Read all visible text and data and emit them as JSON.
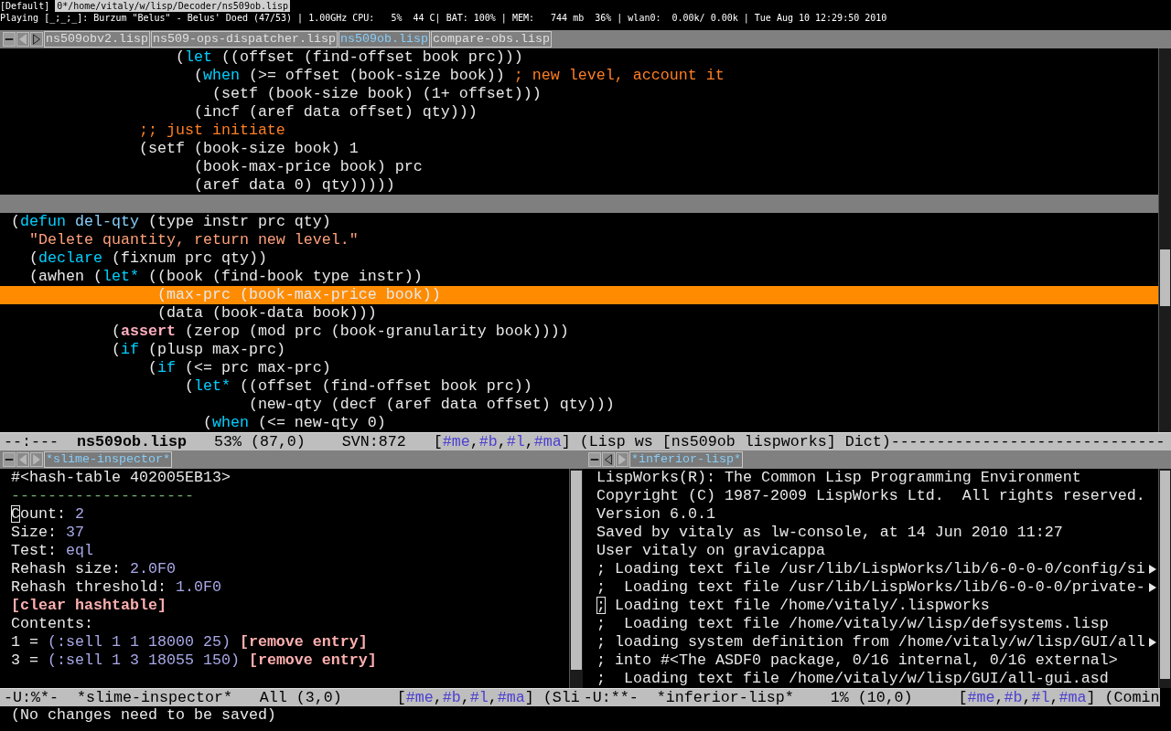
{
  "status_bar": {
    "workspace": "[Default]",
    "path": "0*/home/vitaly/w/lisp/Decoder/ns509ob.lisp",
    "info": "Playing [_;_;_]: Burzum \"Belus\" - Belus' Doed (47/53) | 1.00GHz CPU:   5%  44 C| BAT: 100% | MEM:   744 mb  36% | wlan0:  0.00k/ 0.00k | Tue Aug 10 12:29:50 2010"
  },
  "top_window": {
    "tabs": [
      {
        "label": "ns509obv2.lisp",
        "selected": false
      },
      {
        "label": "ns509-ops-dispatcher.lisp",
        "selected": false
      },
      {
        "label": "ns509ob.lisp",
        "selected": true
      },
      {
        "label": "compare-obs.lisp",
        "selected": false
      }
    ],
    "lines": [
      {
        "kind": "code",
        "highlighted": false,
        "segments": [
          {
            "kind": "plain",
            "text": "                  ("
          },
          {
            "kind": "keyword",
            "text": "let"
          },
          {
            "kind": "plain",
            "text": " ((offset (find-offset book prc)))"
          }
        ]
      },
      {
        "kind": "code",
        "highlighted": false,
        "segments": [
          {
            "kind": "plain",
            "text": "                    ("
          },
          {
            "kind": "keyword",
            "text": "when"
          },
          {
            "kind": "plain",
            "text": " (>= offset (book-size book)) "
          },
          {
            "kind": "comment",
            "text": "; new level, account it"
          }
        ]
      },
      {
        "kind": "code",
        "highlighted": false,
        "segments": [
          {
            "kind": "plain",
            "text": "                      (setf (book-size book) (1+ offset)))"
          }
        ]
      },
      {
        "kind": "code",
        "highlighted": false,
        "segments": [
          {
            "kind": "plain",
            "text": "                    (incf (aref data offset) qty)))"
          }
        ]
      },
      {
        "kind": "code",
        "highlighted": false,
        "segments": [
          {
            "kind": "comment",
            "text": "              ;; just initiate"
          }
        ]
      },
      {
        "kind": "code",
        "highlighted": false,
        "segments": [
          {
            "kind": "plain",
            "text": "              (setf (book-size book) 1"
          }
        ]
      },
      {
        "kind": "code",
        "highlighted": false,
        "segments": [
          {
            "kind": "plain",
            "text": "                    (book-max-price book) prc"
          }
        ]
      },
      {
        "kind": "code",
        "highlighted": false,
        "segments": [
          {
            "kind": "plain",
            "text": "                    (aref data 0) qty)))))"
          }
        ]
      },
      {
        "kind": "rule",
        "highlighted": false
      },
      {
        "kind": "code",
        "highlighted": false,
        "segments": [
          {
            "kind": "plain",
            "text": "("
          },
          {
            "kind": "keyword",
            "text": "defun "
          },
          {
            "kind": "name",
            "text": "del-qty"
          },
          {
            "kind": "plain",
            "text": " (type instr prc qty)"
          }
        ]
      },
      {
        "kind": "code",
        "highlighted": false,
        "segments": [
          {
            "kind": "string",
            "text": "  \"Delete quantity, return new level.\""
          }
        ]
      },
      {
        "kind": "code",
        "highlighted": false,
        "segments": [
          {
            "kind": "plain",
            "text": "  ("
          },
          {
            "kind": "keyword",
            "text": "declare"
          },
          {
            "kind": "plain",
            "text": " (fixnum prc qty))"
          }
        ]
      },
      {
        "kind": "code",
        "highlighted": false,
        "segments": [
          {
            "kind": "plain",
            "text": "  (awhen ("
          },
          {
            "kind": "keyword",
            "text": "let*"
          },
          {
            "kind": "plain",
            "text": " ((book (find-book type instr))"
          }
        ]
      },
      {
        "kind": "code",
        "highlighted": true,
        "segments": [
          {
            "kind": "plain",
            "text": "                (max-prc (book-max-price book))"
          }
        ]
      },
      {
        "kind": "code",
        "highlighted": false,
        "segments": [
          {
            "kind": "plain",
            "text": "                (data (book-data book)))"
          }
        ]
      },
      {
        "kind": "code",
        "highlighted": false,
        "segments": [
          {
            "kind": "plain",
            "text": "           ("
          },
          {
            "kind": "builtin",
            "text": "assert"
          },
          {
            "kind": "plain",
            "text": " (zerop (mod prc (book-granularity book))))"
          }
        ]
      },
      {
        "kind": "code",
        "highlighted": false,
        "segments": [
          {
            "kind": "plain",
            "text": "           ("
          },
          {
            "kind": "keyword",
            "text": "if"
          },
          {
            "kind": "plain",
            "text": " (plusp max-prc)"
          }
        ]
      },
      {
        "kind": "code",
        "highlighted": false,
        "segments": [
          {
            "kind": "plain",
            "text": "               ("
          },
          {
            "kind": "keyword",
            "text": "if"
          },
          {
            "kind": "plain",
            "text": " (<= prc max-prc)"
          }
        ]
      },
      {
        "kind": "code",
        "highlighted": false,
        "segments": [
          {
            "kind": "plain",
            "text": "                   ("
          },
          {
            "kind": "keyword",
            "text": "let*"
          },
          {
            "kind": "plain",
            "text": " ((offset (find-offset book prc))"
          }
        ]
      },
      {
        "kind": "code",
        "highlighted": false,
        "segments": [
          {
            "kind": "plain",
            "text": "                          (new-qty (decf (aref data offset) qty)))"
          }
        ]
      },
      {
        "kind": "code",
        "highlighted": false,
        "segments": [
          {
            "kind": "plain",
            "text": "                     ("
          },
          {
            "kind": "keyword",
            "text": "when"
          },
          {
            "kind": "plain",
            "text": " (<= new-qty 0)"
          }
        ]
      }
    ],
    "mode_line": [
      {
        "kind": "ml",
        "text": "--:---  "
      },
      {
        "kind": "ml-bold",
        "text": "ns509ob.lisp"
      },
      {
        "kind": "ml",
        "text": "   53% (87,0)    SVN:872   ["
      },
      {
        "kind": "ml-tag",
        "text": "#me"
      },
      {
        "kind": "ml",
        "text": ","
      },
      {
        "kind": "ml-tag",
        "text": "#b"
      },
      {
        "kind": "ml",
        "text": ","
      },
      {
        "kind": "ml-tag",
        "text": "#l"
      },
      {
        "kind": "ml",
        "text": ","
      },
      {
        "kind": "ml-tag",
        "text": "#ma"
      },
      {
        "kind": "ml",
        "text": "] (Lisp ws [ns509ob lispworks] Dict)------------------------------"
      }
    ]
  },
  "bottom_left": {
    "tabs": [
      {
        "label": "*slime-inspector*",
        "selected": true
      }
    ],
    "lines": [
      {
        "segments": [
          {
            "kind": "plain",
            "text": "#<hash-table 402005EB13>"
          }
        ]
      },
      {
        "segments": [
          {
            "kind": "rule",
            "text": "--------------------"
          }
        ]
      },
      {
        "segments": [
          {
            "kind": "cursor",
            "text": "C"
          },
          {
            "kind": "plain",
            "text": "ount: "
          },
          {
            "kind": "value",
            "text": "2"
          }
        ]
      },
      {
        "segments": [
          {
            "kind": "plain",
            "text": "Size: "
          },
          {
            "kind": "value",
            "text": "37"
          }
        ]
      },
      {
        "segments": [
          {
            "kind": "plain",
            "text": "Test: "
          },
          {
            "kind": "value",
            "text": "eql"
          }
        ]
      },
      {
        "segments": [
          {
            "kind": "plain",
            "text": "Rehash size: "
          },
          {
            "kind": "value",
            "text": "2.0F0"
          }
        ]
      },
      {
        "segments": [
          {
            "kind": "plain",
            "text": "Rehash threshold: "
          },
          {
            "kind": "value",
            "text": "1.0F0"
          }
        ]
      },
      {
        "segments": [
          {
            "kind": "action",
            "text": "[clear hashtable]"
          }
        ]
      },
      {
        "segments": [
          {
            "kind": "plain",
            "text": "Contents:"
          }
        ]
      },
      {
        "segments": [
          {
            "kind": "plain",
            "text": "1 = "
          },
          {
            "kind": "value",
            "text": "(:sell 1 1 18000 25) "
          },
          {
            "kind": "action",
            "text": "[remove entry]"
          }
        ]
      },
      {
        "segments": [
          {
            "kind": "plain",
            "text": "3 = "
          },
          {
            "kind": "value",
            "text": "(:sell 1 3 18055 150) "
          },
          {
            "kind": "action",
            "text": "[remove entry]"
          }
        ]
      }
    ],
    "mode_line": [
      {
        "kind": "ml",
        "text": "-U:%*-  *slime-inspector*   All (3,0)      ["
      },
      {
        "kind": "ml-tag",
        "text": "#me"
      },
      {
        "kind": "ml",
        "text": ","
      },
      {
        "kind": "ml-tag",
        "text": "#b"
      },
      {
        "kind": "ml",
        "text": ","
      },
      {
        "kind": "ml-tag",
        "text": "#l"
      },
      {
        "kind": "ml",
        "text": ","
      },
      {
        "kind": "ml-tag",
        "text": "#ma"
      },
      {
        "kind": "ml",
        "text": "] (Sli"
      }
    ]
  },
  "bottom_right": {
    "tabs": [
      {
        "label": "*inferior-lisp*",
        "selected": true
      }
    ],
    "lines": [
      {
        "continued": false,
        "segments": [
          {
            "kind": "plain",
            "text": "LispWorks(R): The Common Lisp Programming Environment"
          }
        ]
      },
      {
        "continued": false,
        "segments": [
          {
            "kind": "plain",
            "text": "Copyright (C) 1987-2009 LispWorks Ltd.  All rights reserved."
          }
        ]
      },
      {
        "continued": false,
        "segments": [
          {
            "kind": "plain",
            "text": "Version 6.0.1"
          }
        ]
      },
      {
        "continued": false,
        "segments": [
          {
            "kind": "plain",
            "text": "Saved by vitaly as lw-console, at 14 Jun 2010 11:27"
          }
        ]
      },
      {
        "continued": false,
        "segments": [
          {
            "kind": "plain",
            "text": "User vitaly on gravicappa"
          }
        ]
      },
      {
        "continued": true,
        "segments": [
          {
            "kind": "plain",
            "text": "; Loading text file /usr/lib/LispWorks/lib/6-0-0-0/config/si"
          }
        ]
      },
      {
        "continued": true,
        "segments": [
          {
            "kind": "plain",
            "text": ";  Loading text file /usr/lib/LispWorks/lib/6-0-0-0/private-"
          }
        ]
      },
      {
        "continued": false,
        "segments": [
          {
            "kind": "cursor",
            "text": ";"
          },
          {
            "kind": "plain",
            "text": " Loading text file /home/vitaly/.lispworks"
          }
        ]
      },
      {
        "continued": false,
        "segments": [
          {
            "kind": "plain",
            "text": ";  Loading text file /home/vitaly/w/lisp/defsystems.lisp"
          }
        ]
      },
      {
        "continued": true,
        "segments": [
          {
            "kind": "plain",
            "text": "; loading system definition from /home/vitaly/w/lisp/GUI/all"
          }
        ]
      },
      {
        "continued": false,
        "segments": [
          {
            "kind": "plain",
            "text": "; into #<The ASDF0 package, 0/16 internal, 0/16 external>"
          }
        ]
      },
      {
        "continued": false,
        "segments": [
          {
            "kind": "plain",
            "text": ";  Loading text file /home/vitaly/w/lisp/GUI/all-gui.asd"
          }
        ]
      }
    ],
    "mode_line": [
      {
        "kind": "ml",
        "text": "-U:**-  *inferior-lisp*    1% (10,0)     ["
      },
      {
        "kind": "ml-tag",
        "text": "#me"
      },
      {
        "kind": "ml",
        "text": ","
      },
      {
        "kind": "ml-tag",
        "text": "#b"
      },
      {
        "kind": "ml",
        "text": ","
      },
      {
        "kind": "ml-tag",
        "text": "#l"
      },
      {
        "kind": "ml",
        "text": ","
      },
      {
        "kind": "ml-tag",
        "text": "#ma"
      },
      {
        "kind": "ml",
        "text": "] (Comin"
      }
    ]
  },
  "echo_area": "(No changes need to be saved)"
}
